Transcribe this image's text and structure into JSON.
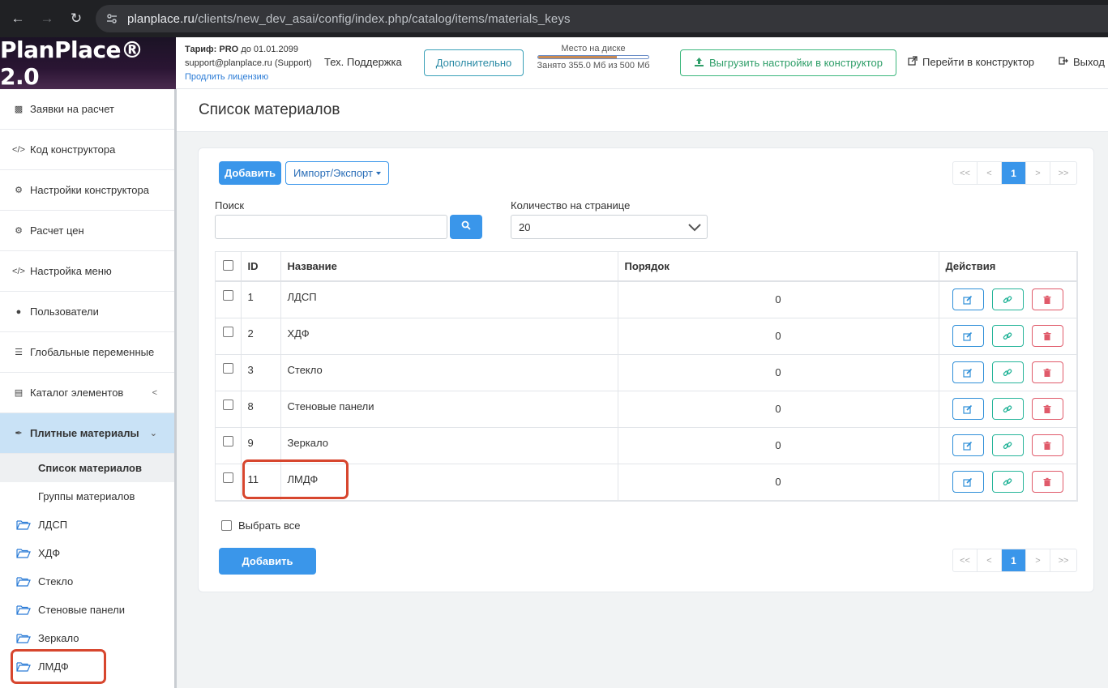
{
  "browser": {
    "url_host": "planplace.ru",
    "url_path": "/clients/new_dev_asai/config/index.php/catalog/items/materials_keys"
  },
  "header": {
    "logo": "PlanPlace® 2.0",
    "tariff_label": "Тариф:",
    "tariff_value": "PRO",
    "tariff_until": "до 01.01.2099",
    "support_email": "support@planplace.ru (Support)",
    "renew_link": "Продлить лицензию",
    "tech_support": "Тех. Поддержка",
    "more_button": "Дополнительно",
    "disk_label": "Место на диске",
    "disk_usage": "Занято 355.0 Мб из 500 Мб",
    "disk_used_fraction": 0.71,
    "export_button": "Выгрузить настройки в конструктор",
    "go_constructor": "Перейти в конструктор",
    "logout": "Выход"
  },
  "sidebar": {
    "items": [
      {
        "label": "Заявки на расчет",
        "icon": "clipboard-icon"
      },
      {
        "label": "Код конструктора",
        "icon": "code-icon"
      },
      {
        "label": "Настройки конструктора",
        "icon": "gears-icon"
      },
      {
        "label": "Расчет цен",
        "icon": "gears-icon"
      },
      {
        "label": "Настройка меню",
        "icon": "code-icon"
      },
      {
        "label": "Пользователи",
        "icon": "user-icon"
      },
      {
        "label": "Глобальные переменные",
        "icon": "list-icon"
      },
      {
        "label": "Каталог элементов",
        "icon": "book-icon"
      },
      {
        "label": "Плитные материалы",
        "icon": "brush-icon"
      }
    ],
    "sub_items": [
      "Список материалов",
      "Группы материалов"
    ],
    "folders": [
      "ЛДСП",
      "ХДФ",
      "Стекло",
      "Стеновые панели",
      "Зеркало",
      "ЛМДФ"
    ]
  },
  "main": {
    "title": "Список материалов",
    "add_button": "Добавить",
    "import_export": "Импорт/Экспорт",
    "search_label": "Поиск",
    "search_value": "",
    "per_page_label": "Количество на странице",
    "per_page_value": "20",
    "pager": [
      "<<",
      "<",
      "1",
      ">",
      ">>"
    ],
    "table": {
      "headers": [
        "ID",
        "Название",
        "Порядок",
        "Действия"
      ],
      "rows": [
        {
          "id": "1",
          "name": "ЛДСП",
          "order": "0"
        },
        {
          "id": "2",
          "name": "ХДФ",
          "order": "0"
        },
        {
          "id": "3",
          "name": "Стекло",
          "order": "0"
        },
        {
          "id": "8",
          "name": "Стеновые панели",
          "order": "0"
        },
        {
          "id": "9",
          "name": "Зеркало",
          "order": "0"
        },
        {
          "id": "11",
          "name": "ЛМДФ",
          "order": "0"
        }
      ]
    },
    "select_all": "Выбрать все",
    "add_button_bottom": "Добавить"
  },
  "colors": {
    "accent": "#3a96ea",
    "highlight": "#d7462e",
    "sidebar_active": "#c9e2f6"
  }
}
